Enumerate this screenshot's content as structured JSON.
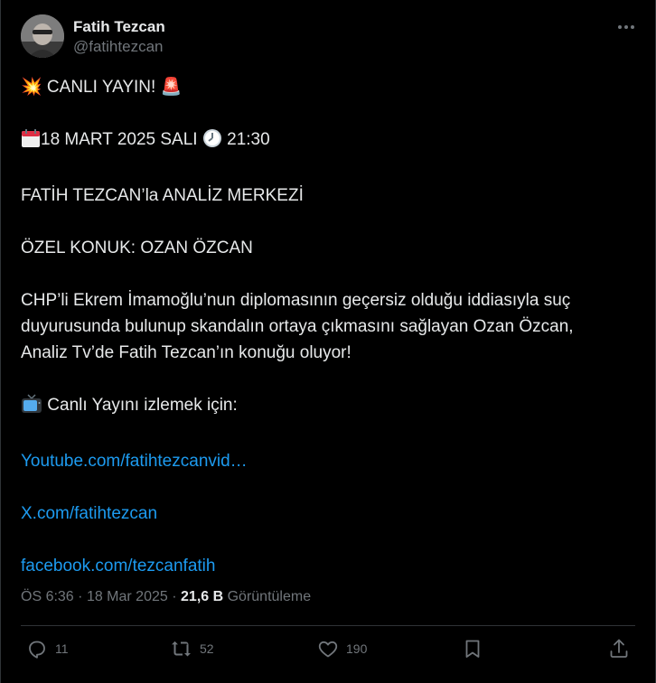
{
  "author": {
    "display_name": "Fatih Tezcan",
    "handle": "@fatihtezcan"
  },
  "post": {
    "line1": "💥 CANLI YAYIN! 🚨",
    "line2_date": "18 MART 2025 SALI",
    "line2_time": "21:30",
    "line3": "FATİH TEZCAN’la ANALİZ MERKEZİ",
    "line4": "ÖZEL KONUK: OZAN ÖZCAN",
    "para1_line1": "CHP’li Ekrem İmamoğlu’nun diplomasının geçersiz olduğu iddiasıyla suç",
    "para1_line2": "duyurusunda bulunup skandalın ortaya çıkmasını sağlayan Ozan Özcan,",
    "para1_line3": "Analiz Tv’de Fatih Tezcan’ın konuğu oluyor!",
    "watch_label": "Canlı Yayını izlemek için:",
    "links": [
      "Youtube.com/fatihtezcanvid…",
      "X.com/fatihtezcan",
      "facebook.com/tezcanfatih"
    ]
  },
  "meta": {
    "time": "ÖS 6:36",
    "date": "18 Mar 2025",
    "views_count": "21,6 B",
    "views_label": "Görüntüleme"
  },
  "actions": {
    "replies": "11",
    "reposts": "52",
    "likes": "190"
  },
  "colors": {
    "background": "#000000",
    "text": "#e7e9ea",
    "muted": "#71767b",
    "link": "#1d9bf0",
    "border": "#2f3336"
  },
  "icons": [
    "more-icon",
    "collision-emoji",
    "siren-emoji",
    "calendar-emoji",
    "clock-emoji",
    "tv-emoji",
    "reply-icon",
    "repost-icon",
    "like-icon",
    "bookmark-icon",
    "share-icon"
  ]
}
